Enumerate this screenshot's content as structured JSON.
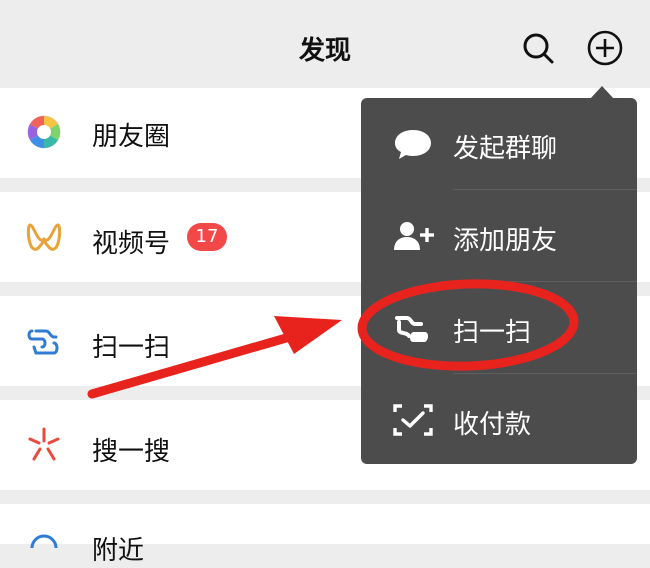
{
  "header": {
    "title": "发现"
  },
  "list": {
    "moments": "朋友圈",
    "channels": "视频号",
    "channels_badge": "17",
    "scan": "扫一扫",
    "search": "搜一搜",
    "nearby": "附近"
  },
  "menu": {
    "items": [
      {
        "label": "发起群聊",
        "icon": "chat-bubble-icon"
      },
      {
        "label": "添加朋友",
        "icon": "add-friend-icon"
      },
      {
        "label": "扫一扫",
        "icon": "scan-icon"
      },
      {
        "label": "收付款",
        "icon": "money-icon"
      }
    ]
  },
  "colors": {
    "background": "#ededed",
    "menu": "#4c4c4c",
    "badge": "#f24848",
    "annotation": "#e8231e",
    "scan_icon": "#2f7bd6",
    "channels_icon": "#e8a33a"
  }
}
